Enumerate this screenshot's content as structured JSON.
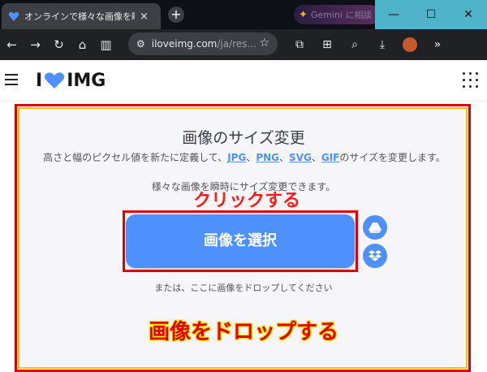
{
  "browser": {
    "tab_title": "オンラインで様々な画像を瞬時にサ",
    "tab_close": "×",
    "new_tab": "+",
    "gemini_label": "Gemini に相談",
    "url_host": "iloveimg.com",
    "url_path": "/ja/res...",
    "window_controls": {
      "minimize": "—",
      "maximize": "☐",
      "close": "✕"
    },
    "icons": [
      "back-icon",
      "forward-icon",
      "reload-icon",
      "home-icon",
      "reading-mode-icon",
      "extensions-icon",
      "translate-icon",
      "lens-icon",
      "download-icon",
      "profile-avatar",
      "more-icon"
    ]
  },
  "site": {
    "logo_left": "I",
    "logo_right": "IMG",
    "brand_color": "#4d90fe",
    "title": "画像のサイズ変更",
    "description_prefix": "高さと幅のピクセル値を新たに定義して、",
    "formats": [
      "JPG",
      "PNG",
      "SVG",
      "GIF"
    ],
    "sep": "、",
    "description_suffix": "のサイズを変更します。",
    "description_line2": "様々な画像を瞬時にサイズ変更できます。",
    "select_button": "画像を選択",
    "drop_hint": "または、ここに画像をドロップしてください",
    "cloud_icons": [
      "google-drive-icon",
      "dropbox-icon"
    ]
  },
  "annotations": {
    "click_label": "クリックする",
    "drop_label": "画像をドロップする",
    "highlight_color": "#e00000",
    "outline_color": "#f2c200"
  }
}
